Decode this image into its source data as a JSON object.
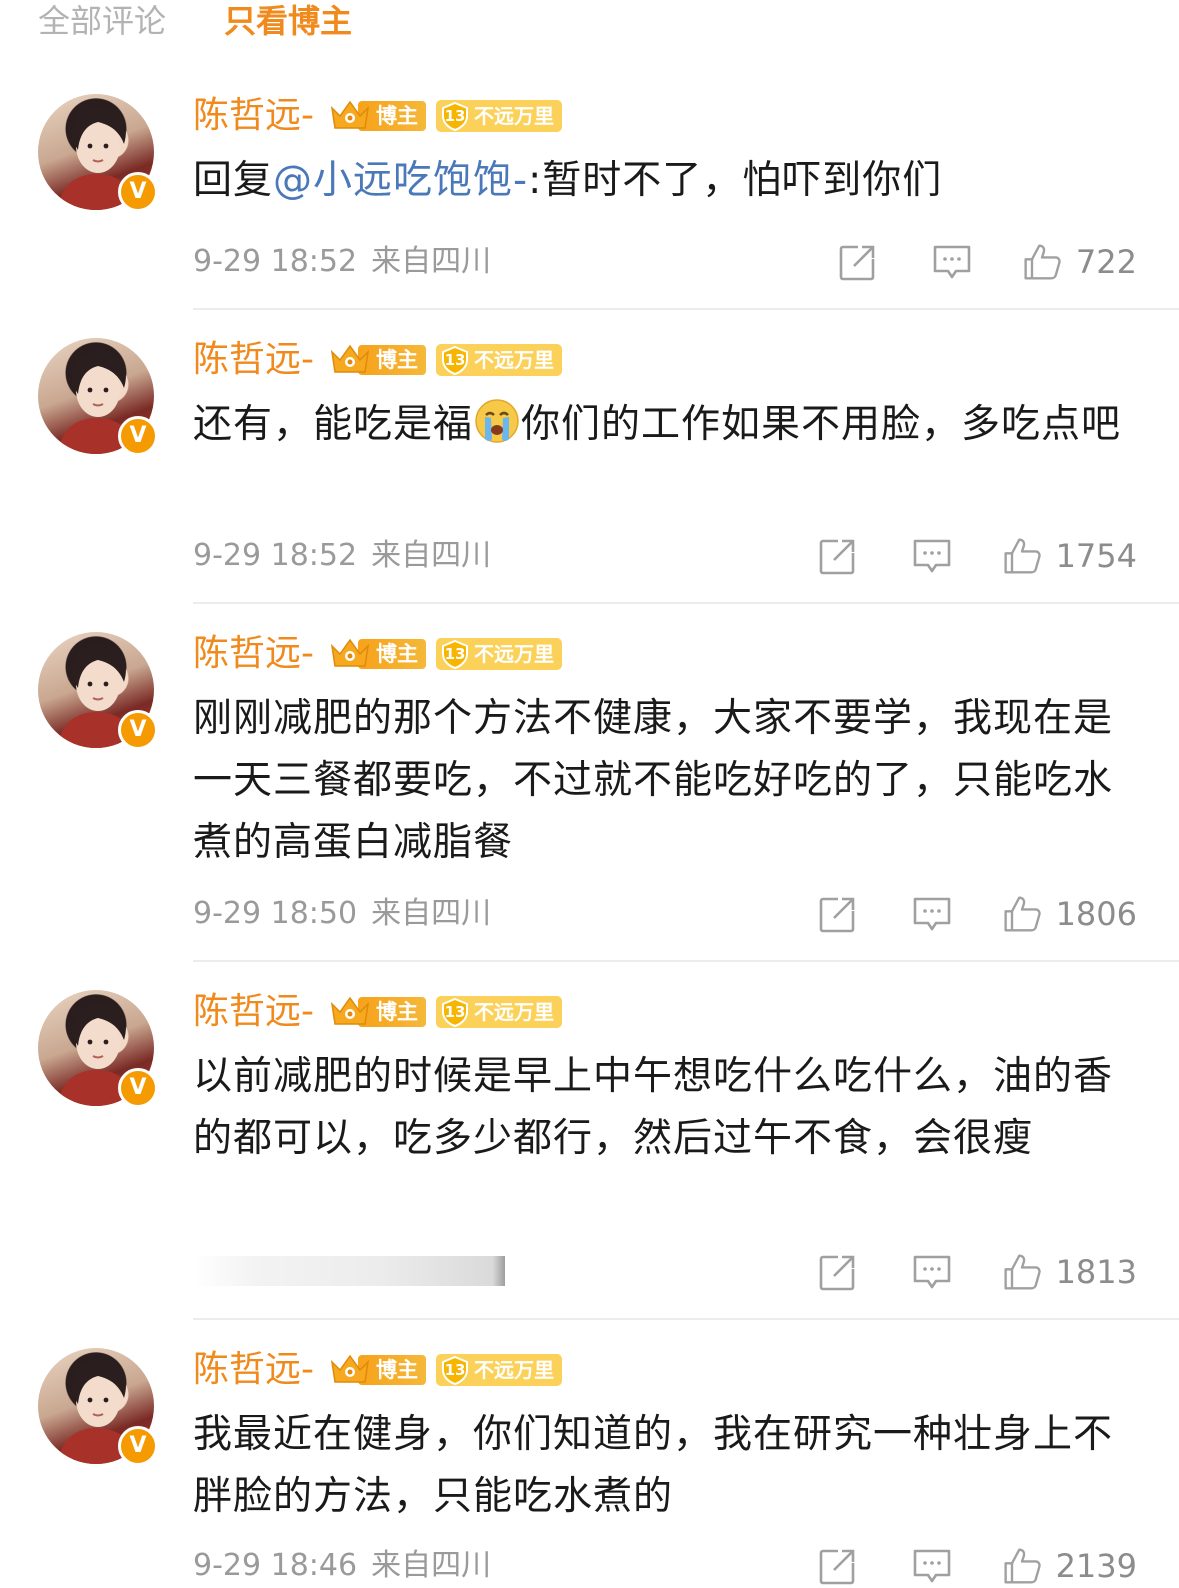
{
  "tabs": {
    "all_label": "全部评论",
    "blogger_only_label": "只看博主"
  },
  "badges": {
    "blogger_label": "博主",
    "level_number": "13",
    "level_title": "不远万里",
    "verified_mark": "V"
  },
  "colors": {
    "accent_orange": "#f08a1c",
    "mention_blue": "#4a78b8",
    "meta_gray": "#9a9a9a",
    "badge_gold": "#fbd15a"
  },
  "icons": {
    "avatar_badge": "verified-v-icon",
    "blogger_badge": "crown-icon",
    "level_badge": "level-shield-icon",
    "forward": "forward-icon",
    "comment": "comment-icon",
    "like": "thumbs-up-icon",
    "emoji": "crying-emoji-icon"
  },
  "comments": [
    {
      "username": "陈哲远-",
      "reply_prefix": "回复",
      "mention": "@小远吃饱饱-",
      "text": ":暂时不了，怕吓到你们",
      "date": "9-29 18:52",
      "location": "来自四川",
      "likes": "722"
    },
    {
      "username": "陈哲远-",
      "text_before_emoji": "还有，能吃是福",
      "text_after_emoji": "你们的工作如果不用脸，多吃点吧",
      "date": "9-29 18:52",
      "location": "来自四川",
      "likes": "1754"
    },
    {
      "username": "陈哲远-",
      "text": "刚刚减肥的那个方法不健康，大家不要学，我现在是一天三餐都要吃，不过就不能吃好吃的了，只能吃水煮的高蛋白减脂餐",
      "date": "9-29 18:50",
      "location": "来自四川",
      "likes": "1806"
    },
    {
      "username": "陈哲远-",
      "text": "以前减肥的时候是早上中午想吃什么吃什么，油的香的都可以，吃多少都行，然后过午不食，会很瘦",
      "likes": "1813"
    },
    {
      "username": "陈哲远-",
      "text": "我最近在健身，你们知道的，我在研究一种壮身上不胖脸的方法，只能吃水煮的",
      "date": "9-29 18:46",
      "location": "来自四川",
      "likes": "2139"
    }
  ]
}
